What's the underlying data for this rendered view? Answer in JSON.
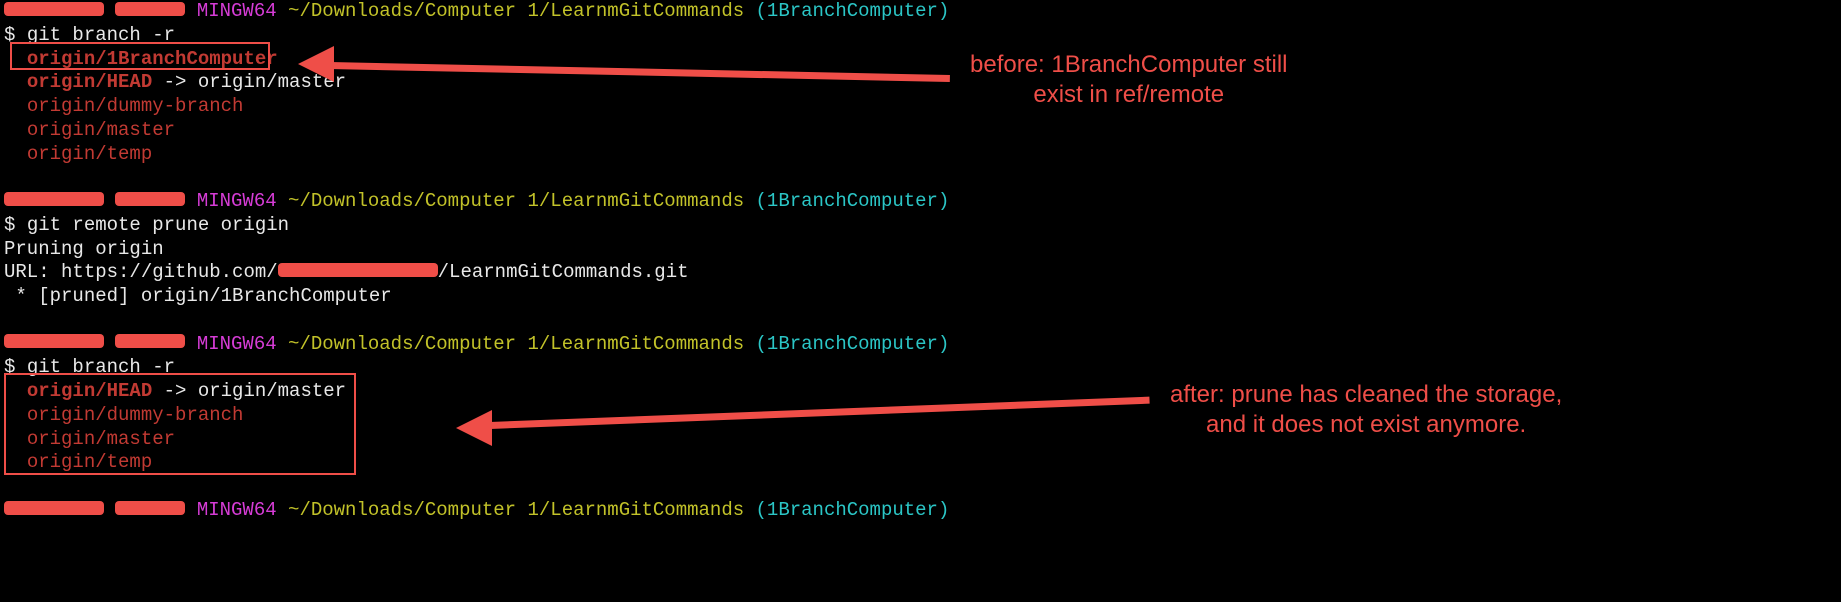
{
  "prompt": {
    "mingw": "MINGW64",
    "path": "~/Downloads/Computer 1/LearnmGitCommands",
    "branch": "(1BranchComputer)",
    "symbol": "$"
  },
  "blocks": [
    {
      "cmd": "git branch -r",
      "out_ref": "branches_before"
    },
    {
      "cmd": "git remote prune origin",
      "out_ref": "prune_output"
    },
    {
      "cmd": "git branch -r",
      "out_ref": "branches_after"
    }
  ],
  "branches_before": {
    "b1": "origin/1BranchComputer",
    "b2a": "origin/HEAD",
    "b2b": " -> origin/master",
    "b3": "origin/dummy-branch",
    "b4": "origin/master",
    "b5": "origin/temp"
  },
  "prune_output": {
    "l1": "Pruning origin",
    "l2a": "URL: https://github.com/",
    "l2b": "/LearnmGitCommands.git",
    "l3": " * [pruned] origin/1BranchComputer"
  },
  "branches_after": {
    "b1a": "origin/HEAD",
    "b1b": " -> origin/master",
    "b2": "origin/dummy-branch",
    "b3": "origin/master",
    "b4": "origin/temp"
  },
  "annotations": {
    "before": "before: 1BranchComputer still\nexist in ref/remote",
    "after": "after: prune has cleaned the storage,\nand it does not exist anymore."
  }
}
